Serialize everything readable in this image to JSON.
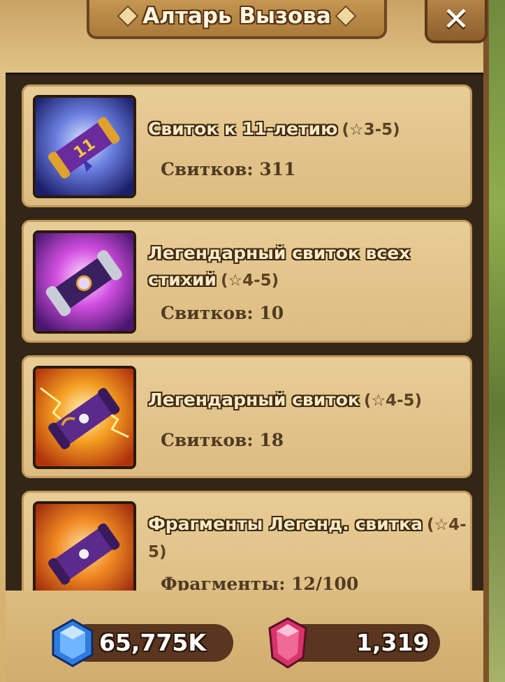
{
  "header": {
    "title": "Алтарь Вызова",
    "close_label": "✕"
  },
  "scrolls": [
    {
      "name": "Свиток к 11-летию",
      "stars": "(☆3-5)",
      "count_text": "Свитков: 311",
      "icon": "anniversary-scroll-icon"
    },
    {
      "name": "Легендарный свиток всех стихий",
      "stars": "(☆4-5)",
      "count_text": "Свитков: 10",
      "icon": "legendary-all-elements-scroll-icon"
    },
    {
      "name": "Легендарный свиток",
      "stars": "(☆4-5)",
      "count_text": "Свитков: 18",
      "icon": "legendary-scroll-icon"
    },
    {
      "name": "Фрагменты Легенд. свитка",
      "stars": "(☆4-5)",
      "count_text": "Фрагменты: 12/100",
      "icon": "legendary-scroll-fragments-icon"
    }
  ],
  "currency": {
    "crystals": "65,775K",
    "mana_stones": "1,319"
  },
  "colors": {
    "parchment": "#e0c287",
    "card": "#e4c78e",
    "well": "#332518",
    "scroll_purple": "#5b2a8c",
    "scroll_gold": "#e0a22c"
  }
}
